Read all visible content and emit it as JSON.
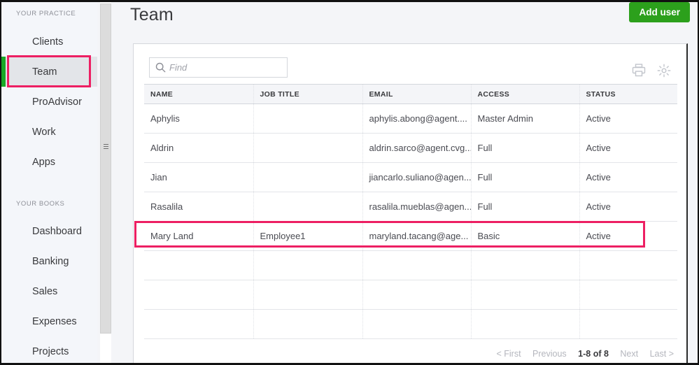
{
  "sidebar": {
    "sections": [
      {
        "label": "YOUR PRACTICE",
        "items": [
          {
            "label": "Clients",
            "selected": false
          },
          {
            "label": "Team",
            "selected": true
          },
          {
            "label": "ProAdvisor",
            "selected": false
          },
          {
            "label": "Work",
            "selected": false
          },
          {
            "label": "Apps",
            "selected": false
          }
        ]
      },
      {
        "label": "YOUR BOOKS",
        "items": [
          {
            "label": "Dashboard",
            "selected": false
          },
          {
            "label": "Banking",
            "selected": false
          },
          {
            "label": "Sales",
            "selected": false
          },
          {
            "label": "Expenses",
            "selected": false
          },
          {
            "label": "Projects",
            "selected": false
          }
        ]
      }
    ]
  },
  "header": {
    "title": "Team",
    "add_user_label": "Add user"
  },
  "toolbar": {
    "search_placeholder": "Find",
    "search_value": "",
    "search_icon": "search-icon",
    "print_icon": "printer-icon",
    "settings_icon": "gear-icon"
  },
  "table": {
    "columns": [
      "NAME",
      "JOB TITLE",
      "EMAIL",
      "ACCESS",
      "STATUS"
    ],
    "rows": [
      {
        "name": "Aphylis",
        "job_title": "",
        "email": "aphylis.abong@agent....",
        "access": "Master Admin",
        "status": "Active",
        "highlighted": false
      },
      {
        "name": "Aldrin",
        "job_title": "",
        "email": "aldrin.sarco@agent.cvg...",
        "access": "Full",
        "status": "Active",
        "highlighted": false
      },
      {
        "name": "Jian",
        "job_title": "",
        "email": "jiancarlo.suliano@agen...",
        "access": "Full",
        "status": "Active",
        "highlighted": false
      },
      {
        "name": "Rasalila",
        "job_title": "",
        "email": "rasalila.mueblas@agen...",
        "access": "Full",
        "status": "Active",
        "highlighted": false
      },
      {
        "name": "Mary Land",
        "job_title": "Employee1",
        "email": "maryland.tacang@age...",
        "access": "Basic",
        "status": "Active",
        "highlighted": true
      }
    ]
  },
  "pagination": {
    "first": "< First",
    "previous": "Previous",
    "range": "1-8 of 8",
    "next": "Next",
    "last": "Last >"
  },
  "colors": {
    "accent_green": "#2ca01c",
    "selected_bar": "#19a825",
    "annotation_pink": "#ed1f63",
    "page_background": "#f4f5f8",
    "sidebar_background": "#f4f6fa"
  }
}
